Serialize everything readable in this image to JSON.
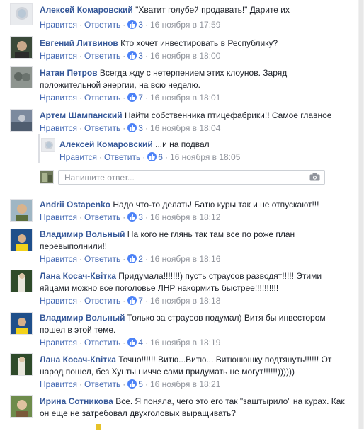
{
  "ui": {
    "like_label": "Нравится",
    "reply_label": "Ответить"
  },
  "comments": [
    {
      "author": "Алексей Комаровский",
      "text": "\"Хватит голубей продавать!\" Дарите их",
      "likes": "3",
      "time": "16 ноября в 17:59"
    },
    {
      "author": "Евгений Литвинов",
      "text": "Кто хочет инвестировать в Республику?",
      "likes": "3",
      "time": "16 ноября в 18:00"
    },
    {
      "author": "Натан Петров",
      "text": "Всегда жду с нетерпением этих клоунов. Заряд положительной энергии, на всю неделю.",
      "likes": "7",
      "time": "16 ноября в 18:01"
    },
    {
      "author": "Артем Шампанский",
      "text": "Найти собственника птицефабрики!! Самое главное",
      "likes": "3",
      "time": "16 ноября в 18:04"
    },
    {
      "author": "Алексей Комаровский",
      "text": "...и на подвал",
      "likes": "6",
      "time": "16 ноября в 18:05"
    },
    {
      "author": "Andrii Ostapenko",
      "text": "Надо что-то делать! Батю куры так и не отпускают!!!",
      "likes": "3",
      "time": "16 ноября в 18:12"
    },
    {
      "author": "Владимир Вольный",
      "text": "На кого не глянь так там все по роже план перевыполнили!!",
      "likes": "2",
      "time": "16 ноября в 18:16"
    },
    {
      "author": "Лана Косач-Квітка",
      "text": "Придумала!!!!!!!) пусть страусов разводят!!!!! Этими яйцами можно все поголовье ЛНР накормить быстрее!!!!!!!!!!",
      "likes": "7",
      "time": "16 ноября в 18:18"
    },
    {
      "author": "Владимир Вольный",
      "text": "Только за страусов подумал) Витя бы инвестором пошел в этой теме.",
      "likes": "4",
      "time": "16 ноября в 18:19"
    },
    {
      "author": "Лана Косач-Квітка",
      "text": "Точно!!!!!! Витю...Витю... Витюнюшку подтянуть!!!!!! От народ пошел, без Хунты ничче сами придумать не могут!!!!!!))))))",
      "likes": "5",
      "time": "16 ноября в 18:21"
    },
    {
      "author": "Ирина Сотникова",
      "text": "Все. Я поняла, чего это его так \"заштырило\" на курах. Как он еще не затребовал двухголовых выращивать?",
      "likes": "",
      "time": ""
    }
  ],
  "composer": {
    "placeholder": "Напишите ответ..."
  },
  "colors": {
    "link": "#4267b2",
    "author": "#365899",
    "meta": "#90949c",
    "like_badge": "#4c82f7"
  }
}
